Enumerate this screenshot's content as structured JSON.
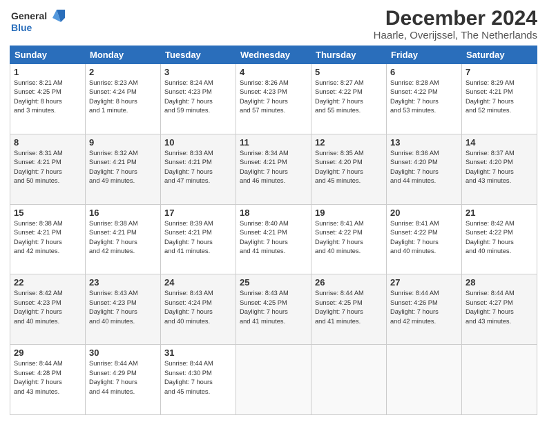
{
  "header": {
    "logo_text_top": "General",
    "logo_text_bottom": "Blue",
    "title": "December 2024",
    "subtitle": "Haarle, Overijssel, The Netherlands"
  },
  "days_of_week": [
    "Sunday",
    "Monday",
    "Tuesday",
    "Wednesday",
    "Thursday",
    "Friday",
    "Saturday"
  ],
  "weeks": [
    [
      {
        "day": "1",
        "info": "Sunrise: 8:21 AM\nSunset: 4:25 PM\nDaylight: 8 hours\nand 3 minutes."
      },
      {
        "day": "2",
        "info": "Sunrise: 8:23 AM\nSunset: 4:24 PM\nDaylight: 8 hours\nand 1 minute."
      },
      {
        "day": "3",
        "info": "Sunrise: 8:24 AM\nSunset: 4:23 PM\nDaylight: 7 hours\nand 59 minutes."
      },
      {
        "day": "4",
        "info": "Sunrise: 8:26 AM\nSunset: 4:23 PM\nDaylight: 7 hours\nand 57 minutes."
      },
      {
        "day": "5",
        "info": "Sunrise: 8:27 AM\nSunset: 4:22 PM\nDaylight: 7 hours\nand 55 minutes."
      },
      {
        "day": "6",
        "info": "Sunrise: 8:28 AM\nSunset: 4:22 PM\nDaylight: 7 hours\nand 53 minutes."
      },
      {
        "day": "7",
        "info": "Sunrise: 8:29 AM\nSunset: 4:21 PM\nDaylight: 7 hours\nand 52 minutes."
      }
    ],
    [
      {
        "day": "8",
        "info": "Sunrise: 8:31 AM\nSunset: 4:21 PM\nDaylight: 7 hours\nand 50 minutes."
      },
      {
        "day": "9",
        "info": "Sunrise: 8:32 AM\nSunset: 4:21 PM\nDaylight: 7 hours\nand 49 minutes."
      },
      {
        "day": "10",
        "info": "Sunrise: 8:33 AM\nSunset: 4:21 PM\nDaylight: 7 hours\nand 47 minutes."
      },
      {
        "day": "11",
        "info": "Sunrise: 8:34 AM\nSunset: 4:21 PM\nDaylight: 7 hours\nand 46 minutes."
      },
      {
        "day": "12",
        "info": "Sunrise: 8:35 AM\nSunset: 4:20 PM\nDaylight: 7 hours\nand 45 minutes."
      },
      {
        "day": "13",
        "info": "Sunrise: 8:36 AM\nSunset: 4:20 PM\nDaylight: 7 hours\nand 44 minutes."
      },
      {
        "day": "14",
        "info": "Sunrise: 8:37 AM\nSunset: 4:20 PM\nDaylight: 7 hours\nand 43 minutes."
      }
    ],
    [
      {
        "day": "15",
        "info": "Sunrise: 8:38 AM\nSunset: 4:21 PM\nDaylight: 7 hours\nand 42 minutes."
      },
      {
        "day": "16",
        "info": "Sunrise: 8:38 AM\nSunset: 4:21 PM\nDaylight: 7 hours\nand 42 minutes."
      },
      {
        "day": "17",
        "info": "Sunrise: 8:39 AM\nSunset: 4:21 PM\nDaylight: 7 hours\nand 41 minutes."
      },
      {
        "day": "18",
        "info": "Sunrise: 8:40 AM\nSunset: 4:21 PM\nDaylight: 7 hours\nand 41 minutes."
      },
      {
        "day": "19",
        "info": "Sunrise: 8:41 AM\nSunset: 4:22 PM\nDaylight: 7 hours\nand 40 minutes."
      },
      {
        "day": "20",
        "info": "Sunrise: 8:41 AM\nSunset: 4:22 PM\nDaylight: 7 hours\nand 40 minutes."
      },
      {
        "day": "21",
        "info": "Sunrise: 8:42 AM\nSunset: 4:22 PM\nDaylight: 7 hours\nand 40 minutes."
      }
    ],
    [
      {
        "day": "22",
        "info": "Sunrise: 8:42 AM\nSunset: 4:23 PM\nDaylight: 7 hours\nand 40 minutes."
      },
      {
        "day": "23",
        "info": "Sunrise: 8:43 AM\nSunset: 4:23 PM\nDaylight: 7 hours\nand 40 minutes."
      },
      {
        "day": "24",
        "info": "Sunrise: 8:43 AM\nSunset: 4:24 PM\nDaylight: 7 hours\nand 40 minutes."
      },
      {
        "day": "25",
        "info": "Sunrise: 8:43 AM\nSunset: 4:25 PM\nDaylight: 7 hours\nand 41 minutes."
      },
      {
        "day": "26",
        "info": "Sunrise: 8:44 AM\nSunset: 4:25 PM\nDaylight: 7 hours\nand 41 minutes."
      },
      {
        "day": "27",
        "info": "Sunrise: 8:44 AM\nSunset: 4:26 PM\nDaylight: 7 hours\nand 42 minutes."
      },
      {
        "day": "28",
        "info": "Sunrise: 8:44 AM\nSunset: 4:27 PM\nDaylight: 7 hours\nand 43 minutes."
      }
    ],
    [
      {
        "day": "29",
        "info": "Sunrise: 8:44 AM\nSunset: 4:28 PM\nDaylight: 7 hours\nand 43 minutes."
      },
      {
        "day": "30",
        "info": "Sunrise: 8:44 AM\nSunset: 4:29 PM\nDaylight: 7 hours\nand 44 minutes."
      },
      {
        "day": "31",
        "info": "Sunrise: 8:44 AM\nSunset: 4:30 PM\nDaylight: 7 hours\nand 45 minutes."
      },
      null,
      null,
      null,
      null
    ]
  ]
}
